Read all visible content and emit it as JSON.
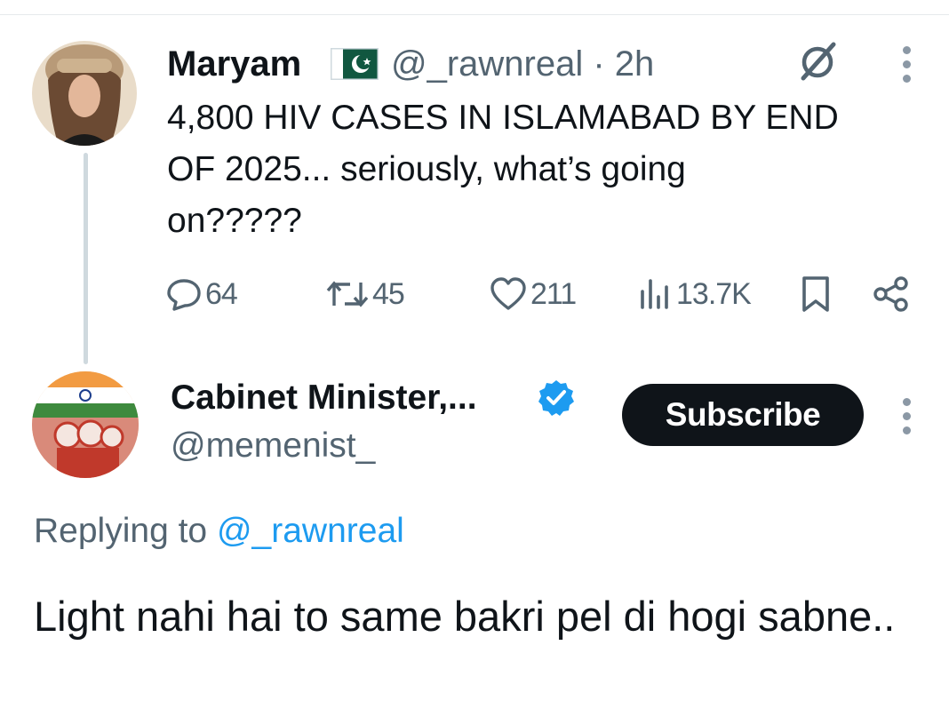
{
  "original_post": {
    "display_name": "Maryam",
    "flag_icon": "pakistan-flag-icon",
    "handle": "@_rawnreal",
    "time": "· 2h",
    "text_lines": [
      "4,800 HIV CASES IN ISLAMABAD BY END",
      "OF 2025... seriously, what’s going",
      "on?????"
    ],
    "actions": {
      "replies": "64",
      "reposts": "45",
      "likes": "211",
      "views": "13.7K"
    }
  },
  "reply_post": {
    "display_name": "Cabinet Minister,...",
    "handle": "@memenist_",
    "subscribe_label": "Subscribe",
    "replying_prefix": "Replying to",
    "replying_mention": "@_rawnreal",
    "text": "Light nahi hai to same bakri pel di hogi sabne.."
  },
  "colors": {
    "primary_text": "#0f1419",
    "secondary_text": "#536471",
    "link": "#1d9bf0",
    "verified": "#1d9bf0",
    "button_bg": "#0f1419"
  }
}
